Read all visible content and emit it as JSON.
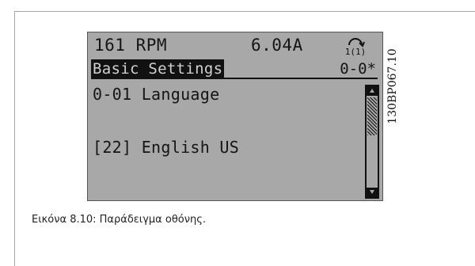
{
  "display": {
    "status_bar": {
      "speed": "161 RPM",
      "current": "6.04A",
      "setup": "1(1)"
    },
    "menu_title": "Basic Settings",
    "menu_code": "0-0*",
    "parameter_name": "0-01 Language",
    "parameter_value": "[22] English US",
    "scrollbar": {
      "position_fraction": 0
    }
  },
  "figure_id": "130BP067.10",
  "caption": "Εικόνα 8.10: Παράδειγμα οθόνης."
}
